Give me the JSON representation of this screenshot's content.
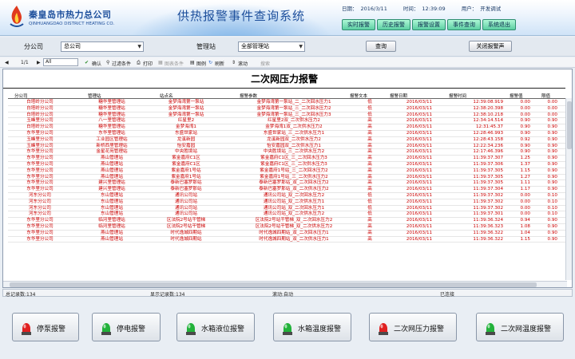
{
  "header": {
    "company_cn": "秦皇岛市热力总公司",
    "company_en": "QINHUANGDAO DISTRICT HEATING CO.",
    "title": "供热报警事件查询系统",
    "date_label": "日期：",
    "date_value": "2016/3/11",
    "time_label": "时间：",
    "time_value": "12:39:09",
    "user_label": "用户：",
    "user_value": "开发调试"
  },
  "nav": [
    {
      "label": "实时报警"
    },
    {
      "label": "历史报警"
    },
    {
      "label": "报警设置"
    },
    {
      "label": "事件查询"
    },
    {
      "label": "系统退出"
    }
  ],
  "filters": {
    "company_label": "分公司",
    "company_value": "总公司",
    "station_label": "管理站",
    "station_value": "全部管理站",
    "query_button": "查询",
    "close_alarm_button": "关闭报警声"
  },
  "toolbar": {
    "page": "1/1",
    "scope": "All",
    "confirm": "确认",
    "filter": "过滤条件",
    "print": "打印",
    "export": "图表条件",
    "chart": "图例",
    "refresh": "刷新",
    "scroll": "滚动",
    "search": "搜索"
  },
  "report": {
    "title": "二次网压力报警",
    "columns": {
      "company": "分公司",
      "station": "管理站",
      "substation": "站点名",
      "alarm_param": "报警参数",
      "alarm_text": "报警文本",
      "alarm_date": "报警日期",
      "alarm_time": "报警时间",
      "alarm_value": "报警值",
      "limit": "限值"
    },
    "rows": [
      {
        "company": "白塔岭分公司",
        "station": "糖华里管理站",
        "substation": "金梦海湾第一泵站",
        "param": "金梦海湾第一泵站_二_二次回水压力1",
        "text": "低",
        "date": "2016/03/11",
        "time": "12:39:08.919",
        "value": "0.00",
        "limit": "0.00"
      },
      {
        "company": "白塔岭分公司",
        "station": "糖华里管理站",
        "substation": "金梦海湾第一泵站",
        "param": "金梦海湾第一泵站_三_二次回水压力2",
        "text": "低",
        "date": "2016/03/11",
        "time": "12:38:20.398",
        "value": "0.00",
        "limit": "0.00"
      },
      {
        "company": "白塔岭分公司",
        "station": "糖华里管理站",
        "substation": "金梦海湾第一泵站",
        "param": "金梦海湾第一泵站_三_二次回水压力3",
        "text": "低",
        "date": "2016/03/11",
        "time": "12:38:10.218",
        "value": "0.00",
        "limit": "0.00"
      },
      {
        "company": "玉峰里分公司",
        "station": "八一里管理站",
        "substation": "红星里2",
        "param": "红星里2双_二次供水压力2",
        "text": "高",
        "date": "2016/03/11",
        "time": "12:34:14.514",
        "value": "0.90",
        "limit": "0.90"
      },
      {
        "company": "白塔岭分公司",
        "station": "糖华里管理站",
        "substation": "金梦海湾1",
        "param": "金梦海湾1双_二次供水压力2",
        "text": "高",
        "date": "2016/03/11",
        "time": "12:31:45.37",
        "value": "0.90",
        "limit": "0.90"
      },
      {
        "company": "东华里分公司",
        "station": "东华里管理站",
        "substation": "东盛世家站",
        "param": "东盛世家站_三_二次供水压力1",
        "text": "高",
        "date": "2016/03/11",
        "time": "12:28:46.993",
        "value": "0.90",
        "limit": "0.90"
      },
      {
        "company": "玉峰里分公司",
        "station": "工业园区管理站",
        "substation": "龙溪新园",
        "param": "龙溪新园双_二次供水压力2",
        "text": "高",
        "date": "2016/03/11",
        "time": "12:28:43.158",
        "value": "0.92",
        "limit": "0.90"
      },
      {
        "company": "玉峰里分公司",
        "station": "新桥西里管理站",
        "substation": "怡安嘉园",
        "param": "怡安嘉园双_二次供水压力1",
        "text": "高",
        "date": "2016/03/11",
        "time": "12:22:34.236",
        "value": "0.90",
        "limit": "0.90"
      },
      {
        "company": "东华里分公司",
        "station": "金星花苑管理站",
        "substation": "中央胜境站",
        "param": "中央胜境站_三_二次供水压力2",
        "text": "高",
        "date": "2016/03/11",
        "time": "12:17:46.396",
        "value": "0.90",
        "limit": "0.90"
      },
      {
        "company": "东华里分公司",
        "station": "燕山管理站",
        "substation": "紫金嘉府C1区",
        "param": "紫金嘉府C1区_三_二次回水压力3",
        "text": "高",
        "date": "2016/03/11",
        "time": "11:39:37.307",
        "value": "1.25",
        "limit": "0.90"
      },
      {
        "company": "东华里分公司",
        "station": "燕山管理站",
        "substation": "紫金嘉府C1区",
        "param": "紫金嘉府C1区_三_二次供水压力3",
        "text": "高",
        "date": "2016/03/11",
        "time": "11:39:37.306",
        "value": "1.37",
        "limit": "0.90"
      },
      {
        "company": "东华里分公司",
        "station": "燕山管理站",
        "substation": "紫金嘉府1号站",
        "param": "紫金嘉府1号站_三_二次回水压力2",
        "text": "高",
        "date": "2016/03/11",
        "time": "11:39:37.305",
        "value": "1.15",
        "limit": "0.90"
      },
      {
        "company": "东华里分公司",
        "station": "燕山管理站",
        "substation": "紫金嘉府1号站",
        "param": "紫金嘉府1号站_三_二次供水压力2",
        "text": "高",
        "date": "2016/03/11",
        "time": "11:39:37.305",
        "value": "1.27",
        "limit": "0.90"
      },
      {
        "company": "东华里分公司",
        "station": "建兴里管理站",
        "substation": "泰新巴塞罗那站",
        "param": "泰新巴塞罗那站_双_二次回水压力2",
        "text": "高",
        "date": "2016/03/11",
        "time": "11:39:37.305",
        "value": "1.11",
        "limit": "0.90"
      },
      {
        "company": "东华里分公司",
        "station": "建兴里管理站",
        "substation": "泰新巴塞罗那站",
        "param": "泰新巴塞罗那站_双_二次供水压力2",
        "text": "高",
        "date": "2016/03/11",
        "time": "11:39:37.304",
        "value": "1.17",
        "limit": "0.90"
      },
      {
        "company": "河东分公司",
        "station": "东山管理站",
        "substation": "通讯公司站",
        "param": "通讯公司站_双_二次回水压力2",
        "text": "低",
        "date": "2016/03/11",
        "time": "11:39:37.302",
        "value": "0.00",
        "limit": "0.10"
      },
      {
        "company": "河东分公司",
        "station": "东山管理站",
        "substation": "通讯公司站",
        "param": "通讯公司站_双_二次供水压力1",
        "text": "低",
        "date": "2016/03/11",
        "time": "11:39:37.302",
        "value": "0.00",
        "limit": "0.10"
      },
      {
        "company": "河东分公司",
        "station": "东山管理站",
        "substation": "通讯公司站",
        "param": "通讯公司站_双_二次回水压力1",
        "text": "低",
        "date": "2016/03/11",
        "time": "11:39:37.302",
        "value": "0.00",
        "limit": "0.10"
      },
      {
        "company": "河东分公司",
        "station": "东山管理站",
        "substation": "通讯公司站",
        "param": "通讯公司站_双_二次供水压力2",
        "text": "低",
        "date": "2016/03/11",
        "time": "11:39:37.301",
        "value": "0.00",
        "limit": "0.10"
      },
      {
        "company": "东华里分公司",
        "station": "临河里管理站",
        "substation": "区法院2号站干管梯",
        "param": "区法院2号站干管梯_双_二次回水压力2",
        "text": "高",
        "date": "2016/03/11",
        "time": "11:39:36.324",
        "value": "0.94",
        "limit": "0.90"
      },
      {
        "company": "东华里分公司",
        "station": "临河里管理站",
        "substation": "区法院2号站干管梯",
        "param": "区法院2号站干管梯_双_二次供水压力2",
        "text": "高",
        "date": "2016/03/11",
        "time": "11:39:36.323",
        "value": "1.08",
        "limit": "0.90"
      },
      {
        "company": "东华里分公司",
        "station": "燕山管理站",
        "substation": "时代逸城四期站",
        "param": "时代逸城四期站_双_二次回水压力1",
        "text": "高",
        "date": "2016/03/11",
        "time": "11:39:36.322",
        "value": "1.04",
        "limit": "0.90"
      },
      {
        "company": "东华里分公司",
        "station": "燕山管理站",
        "substation": "时代逸城四期站",
        "param": "时代逸城四期站_双_二次供水压力1",
        "text": "高",
        "date": "2016/03/11",
        "time": "11:39:36.322",
        "value": "1.15",
        "limit": "0.90"
      }
    ]
  },
  "status": {
    "total_records": "总记录数:134",
    "shown_records": "显示记录数:134",
    "auto_scroll": "滚动:自动",
    "connection": "已连接"
  },
  "alarm_buttons": [
    {
      "label": "停泵报警",
      "color": "#e02020"
    },
    {
      "label": "停电报警",
      "color": "#22b23a"
    },
    {
      "label": "水箱液位报警",
      "color": "#22b23a"
    },
    {
      "label": "水箱温度报警",
      "color": "#22b23a"
    },
    {
      "label": "二次网压力报警",
      "color": "#e02020"
    },
    {
      "label": "二次网温度报警",
      "color": "#22b23a"
    }
  ]
}
